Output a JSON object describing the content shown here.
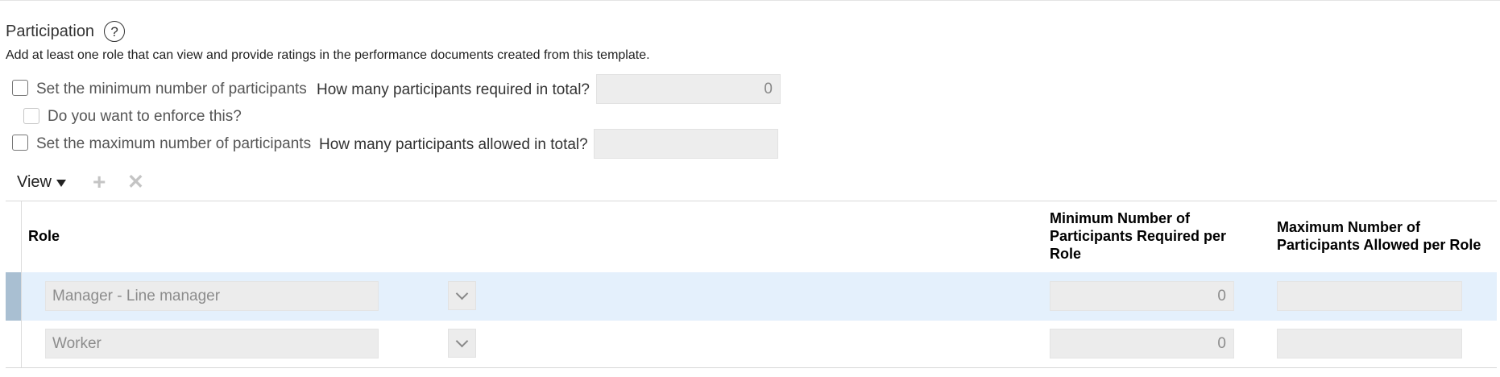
{
  "section": {
    "title": "Participation",
    "help_icon": "?",
    "description": "Add at least one role that can view and provide ratings in the performance documents created from this template."
  },
  "settings": {
    "min_checkbox_label": "Set the minimum number of participants",
    "min_question": "How many participants required in total?",
    "min_value": "0",
    "enforce_label": "Do you want to enforce this?",
    "max_checkbox_label": "Set the maximum number of participants",
    "max_question": "How many participants allowed in total?",
    "max_value": ""
  },
  "toolbar": {
    "view_label": "View",
    "add_icon": "+",
    "remove_icon": "✕"
  },
  "table": {
    "columns": {
      "role": "Role",
      "min_line1": "Minimum Number of",
      "min_line2": "Participants Required per",
      "min_line3": "Role",
      "max_line1": "Maximum Number of",
      "max_line2": "Participants Allowed per Role"
    },
    "rows": [
      {
        "role": "Manager - Line manager",
        "min": "0",
        "max": "",
        "selected": true
      },
      {
        "role": "Worker",
        "min": "0",
        "max": "",
        "selected": false
      }
    ]
  },
  "colors": {
    "selected_row": "#e4f0fc",
    "row_indicator": "#a9bfd2",
    "field_bg": "#ededed"
  }
}
